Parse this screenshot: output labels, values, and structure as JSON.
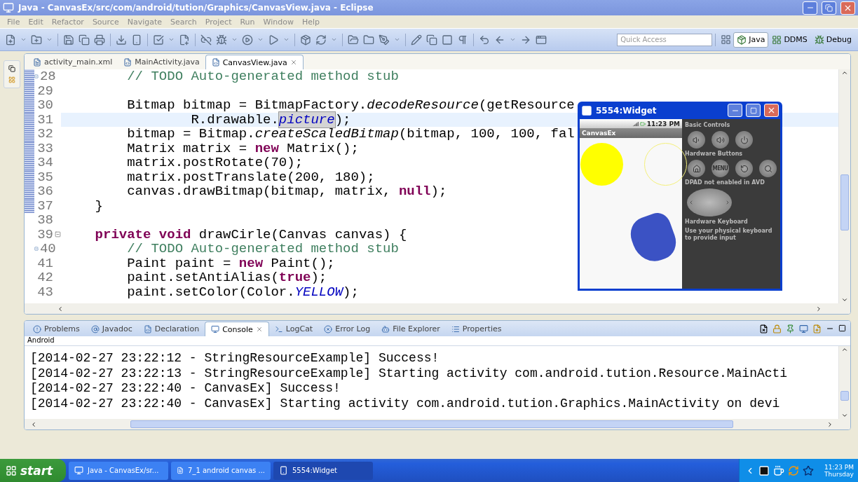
{
  "window": {
    "title": "Java - CanvasEx/src/com/android/tution/Graphics/CanvasView.java - Eclipse"
  },
  "menu": [
    "File",
    "Edit",
    "Refactor",
    "Source",
    "Navigate",
    "Search",
    "Project",
    "Run",
    "Window",
    "Help"
  ],
  "quick_access": {
    "placeholder": "Quick Access"
  },
  "perspectives": [
    {
      "label": "Java",
      "selected": true
    },
    {
      "label": "DDMS",
      "selected": false
    },
    {
      "label": "Debug",
      "selected": false
    }
  ],
  "editor_tabs": [
    {
      "label": "activity_main.xml",
      "kind": "xml",
      "selected": false
    },
    {
      "label": "MainActivity.java",
      "kind": "java",
      "selected": false
    },
    {
      "label": "CanvasView.java",
      "kind": "java",
      "selected": true
    }
  ],
  "code_lines": [
    {
      "number": "28",
      "task_marker": true,
      "fold": false,
      "changed": true,
      "current": false,
      "segments": [
        {
          "kind": "comment",
          "text": "        // TODO Auto-generated method stub"
        }
      ]
    },
    {
      "number": "29",
      "task_marker": false,
      "fold": false,
      "changed": true,
      "current": false
    },
    {
      "number": "30",
      "task_marker": false,
      "fold": false,
      "changed": true,
      "current": false,
      "segments": [
        {
          "kind": "plain",
          "text": "        Bitmap bitmap = BitmapFactory."
        },
        {
          "kind": "static",
          "text": "decodeResource"
        },
        {
          "kind": "plain",
          "text": "(getResource"
        }
      ]
    },
    {
      "number": "31",
      "task_marker": false,
      "fold": false,
      "changed": true,
      "current": true,
      "segments": [
        {
          "kind": "plain",
          "text": "                R.drawable."
        },
        {
          "kind": "field",
          "text": "picture"
        },
        {
          "kind": "plain",
          "text": ");"
        }
      ]
    },
    {
      "number": "32",
      "task_marker": false,
      "fold": false,
      "changed": true,
      "current": false,
      "segments": [
        {
          "kind": "plain",
          "text": "        bitmap = Bitmap."
        },
        {
          "kind": "static",
          "text": "createScaledBitmap"
        },
        {
          "kind": "plain",
          "text": "(bitmap, 100, 100, fal"
        }
      ]
    },
    {
      "number": "33",
      "task_marker": false,
      "fold": false,
      "changed": true,
      "current": false,
      "segments": [
        {
          "kind": "plain",
          "text": "        Matrix matrix = "
        },
        {
          "kind": "keyword",
          "text": "new"
        },
        {
          "kind": "plain",
          "text": " Matrix();"
        }
      ]
    },
    {
      "number": "34",
      "task_marker": false,
      "fold": false,
      "changed": true,
      "current": false,
      "segments": [
        {
          "kind": "plain",
          "text": "        matrix.postRotate(70);"
        }
      ]
    },
    {
      "number": "35",
      "task_marker": false,
      "fold": false,
      "changed": true,
      "current": false,
      "segments": [
        {
          "kind": "plain",
          "text": "        matrix.postTranslate(200, 180);"
        }
      ]
    },
    {
      "number": "36",
      "task_marker": false,
      "fold": false,
      "changed": true,
      "current": false,
      "segments": [
        {
          "kind": "plain",
          "text": "        canvas.drawBitmap(bitmap, matrix, "
        },
        {
          "kind": "keyword",
          "text": "null"
        },
        {
          "kind": "plain",
          "text": ");"
        }
      ]
    },
    {
      "number": "37",
      "task_marker": false,
      "fold": false,
      "changed": true,
      "current": false,
      "segments": [
        {
          "kind": "plain",
          "text": "    }"
        }
      ]
    },
    {
      "number": "38",
      "task_marker": false,
      "fold": false,
      "changed": false,
      "current": false
    },
    {
      "number": "39",
      "task_marker": false,
      "fold": true,
      "changed": false,
      "current": false,
      "segments": [
        {
          "kind": "keyword",
          "text": "    private"
        },
        {
          "kind": "keyword",
          "text": " void"
        },
        {
          "kind": "plain",
          "text": " drawCirle(Canvas canvas) {"
        }
      ]
    },
    {
      "number": "40",
      "task_marker": true,
      "fold": false,
      "changed": false,
      "current": false,
      "segments": [
        {
          "kind": "comment",
          "text": "        // TODO Auto-generated method stub"
        }
      ]
    },
    {
      "number": "41",
      "task_marker": false,
      "fold": false,
      "changed": false,
      "current": false,
      "segments": [
        {
          "kind": "plain",
          "text": "        Paint paint = "
        },
        {
          "kind": "keyword",
          "text": "new"
        },
        {
          "kind": "plain",
          "text": " Paint();"
        }
      ]
    },
    {
      "number": "42",
      "task_marker": false,
      "fold": false,
      "changed": false,
      "current": false,
      "segments": [
        {
          "kind": "plain",
          "text": "        paint.setAntiAlias("
        },
        {
          "kind": "keyword",
          "text": "true"
        },
        {
          "kind": "plain",
          "text": ");"
        }
      ]
    },
    {
      "number": "43",
      "task_marker": false,
      "fold": false,
      "changed": false,
      "current": false,
      "segments": [
        {
          "kind": "plain",
          "text": "        paint.setColor(Color."
        },
        {
          "kind": "field",
          "text": "YELLOW"
        },
        {
          "kind": "plain",
          "text": ");"
        }
      ]
    }
  ],
  "emulator": {
    "title": "5554:Widget",
    "status_time": "11:23 PM",
    "app_title": "CanvasEx",
    "basic_controls": "Basic Controls",
    "hardware_buttons": "Hardware Buttons",
    "menu_button": "MENU",
    "dpad_note": "DPAD not enabled in AVD",
    "keyboard_title": "Hardware Keyboard",
    "keyboard_note": "Use your physical keyboard to provide input"
  },
  "bottom_tabs": [
    {
      "label": "Problems",
      "kind": "problems",
      "selected": false
    },
    {
      "label": "Javadoc",
      "kind": "javadoc",
      "selected": false
    },
    {
      "label": "Declaration",
      "kind": "declaration",
      "selected": false
    },
    {
      "label": "Console",
      "kind": "console",
      "selected": true
    },
    {
      "label": "LogCat",
      "kind": "logcat",
      "selected": false
    },
    {
      "label": "Error Log",
      "kind": "errorlog",
      "selected": false
    },
    {
      "label": "File Explorer",
      "kind": "explorer",
      "selected": false
    },
    {
      "label": "Properties",
      "kind": "properties",
      "selected": false
    }
  ],
  "console": {
    "name": "Android",
    "lines": [
      "[2014-02-27 23:22:12 - StringResourceExample] Success!",
      "[2014-02-27 23:22:13 - StringResourceExample] Starting activity com.android.tution.Resource.MainActi",
      "[2014-02-27 23:22:40 - CanvasEx] Success!",
      "[2014-02-27 23:22:40 - CanvasEx] Starting activity com.android.tution.Graphics.MainActivity on devi"
    ]
  },
  "taskbar": {
    "start": "start",
    "tasks": [
      {
        "label": "Java - CanvasEx/sr...",
        "kind": "eclipse",
        "selected": false
      },
      {
        "label": "7_1 android canvas ...",
        "kind": "document",
        "selected": false
      },
      {
        "label": "5554:Widget",
        "kind": "emulator",
        "selected": true
      }
    ],
    "time": "11:23 PM",
    "day": "Thursday"
  }
}
